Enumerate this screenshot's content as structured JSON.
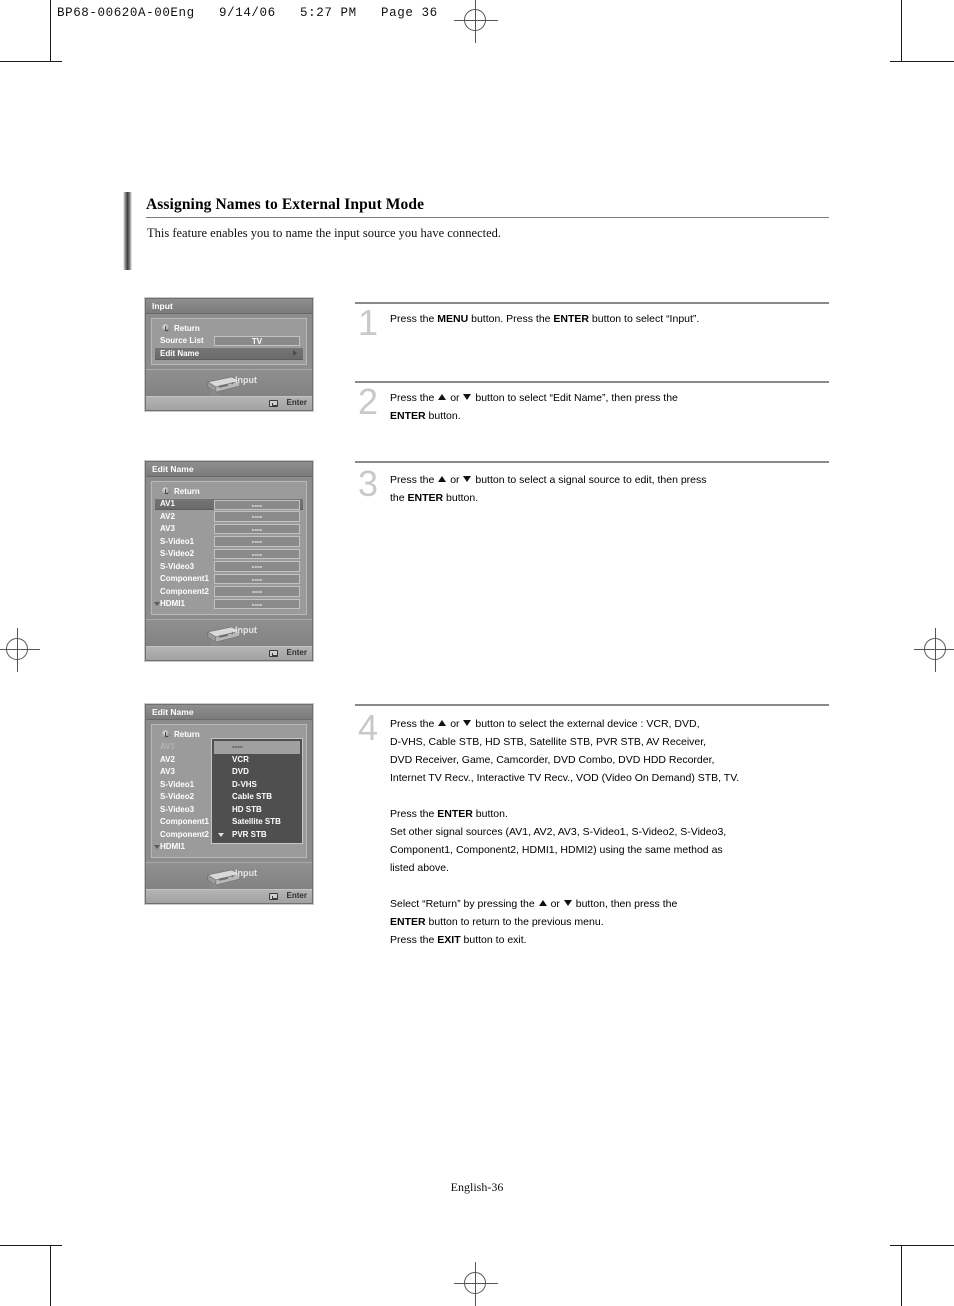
{
  "print_header": "BP68-00620A-00Eng   9/14/06   5:27 PM   Page 36",
  "section": {
    "title": "Assigning Names to External Input Mode",
    "description": "This feature enables you to name the input source you have connected."
  },
  "footer": {
    "page_label": "English-36"
  },
  "osd_menus": [
    {
      "id": "input-menu",
      "title": "Input",
      "rows": [
        {
          "label": "Return",
          "type": "return"
        },
        {
          "label": "Source List",
          "value": "TV",
          "type": "value"
        },
        {
          "label": "Edit Name",
          "type": "submenu",
          "selected": true
        }
      ],
      "footer_label": "Input",
      "enter_label": "Enter"
    },
    {
      "id": "edit-name-menu",
      "title": "Edit Name",
      "rows": [
        {
          "label": "Return",
          "type": "return"
        },
        {
          "label": "AV1",
          "value": "----",
          "type": "value",
          "selected": true
        },
        {
          "label": "AV2",
          "value": "----",
          "type": "value"
        },
        {
          "label": "AV3",
          "value": "----",
          "type": "value"
        },
        {
          "label": "S-Video1",
          "value": "----",
          "type": "value"
        },
        {
          "label": "S-Video2",
          "value": "----",
          "type": "value"
        },
        {
          "label": "S-Video3",
          "value": "----",
          "type": "value"
        },
        {
          "label": "Component1",
          "value": "----",
          "type": "value"
        },
        {
          "label": "Component2",
          "value": "----",
          "type": "value"
        },
        {
          "label": "HDMI1",
          "value": "----",
          "type": "value",
          "more": true
        }
      ],
      "footer_label": "Input",
      "enter_label": "Enter"
    },
    {
      "id": "edit-name-device-menu",
      "title": "Edit Name",
      "rows": [
        {
          "label": "Return",
          "type": "return"
        },
        {
          "label": "AV1",
          "type": "plain",
          "dim": true
        },
        {
          "label": "AV2",
          "type": "plain"
        },
        {
          "label": "AV3",
          "type": "plain"
        },
        {
          "label": "S-Video1",
          "type": "plain"
        },
        {
          "label": "S-Video2",
          "type": "plain"
        },
        {
          "label": "S-Video3",
          "type": "plain"
        },
        {
          "label": "Component1",
          "type": "plain"
        },
        {
          "label": "Component2",
          "type": "plain"
        },
        {
          "label": "HDMI1",
          "type": "plain",
          "more": true
        }
      ],
      "dropdown": [
        {
          "label": "----",
          "selected": true
        },
        {
          "label": "VCR"
        },
        {
          "label": "DVD"
        },
        {
          "label": "D-VHS"
        },
        {
          "label": "Cable STB"
        },
        {
          "label": "HD STB"
        },
        {
          "label": "Satellite STB"
        },
        {
          "label": "PVR STB",
          "more": true
        }
      ],
      "footer_label": "Input",
      "enter_label": "Enter"
    }
  ],
  "steps": [
    {
      "number": "1",
      "lines": [
        "Press the |b:MENU| button. Press the |b:ENTER| button to select “Input”."
      ]
    },
    {
      "number": "2",
      "lines": [
        "Press the |up| or |down| button to select “Edit Name”, then press the",
        "|b:ENTER| button."
      ]
    },
    {
      "number": "3",
      "lines": [
        "Press the |up| or |down| button to select a signal source to edit, then press",
        "the |b:ENTER| button."
      ]
    },
    {
      "number": "4",
      "lines": [
        "Press the |up| or |down| button to select the external device : VCR, DVD,",
        "D-VHS, Cable STB, HD STB, Satellite STB, PVR STB, AV Receiver,",
        "DVD Receiver, Game, Camcorder, DVD Combo, DVD HDD Recorder,",
        "Internet TV Recv., Interactive TV Recv., VOD (Video On Demand) STB, TV.",
        "|gap|",
        "Press the |b:ENTER| button.",
        "Set other signal sources (AV1, AV2, AV3, S-Video1, S-Video2, S-Video3,",
        "Component1, Component2, HDMI1, HDMI2) using the same method as",
        "listed above.",
        "|gap|",
        "Select “Return” by pressing the |up| or |down| button, then press the",
        "|b:ENTER| button to return to the previous menu.",
        "Press the |b:EXIT| button to exit."
      ]
    }
  ]
}
